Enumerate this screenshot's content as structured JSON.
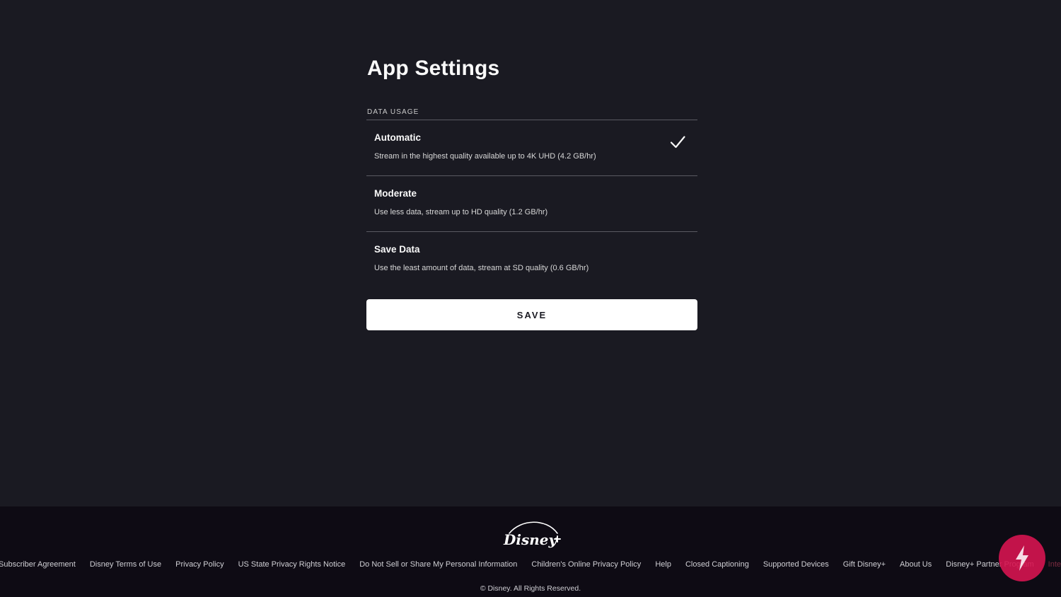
{
  "page": {
    "title": "App Settings"
  },
  "data_usage": {
    "section_label": "DATA USAGE",
    "options": [
      {
        "name": "Automatic",
        "description": "Stream in the highest quality available up to 4K UHD (4.2 GB/hr)",
        "selected": true
      },
      {
        "name": "Moderate",
        "description": "Use less data, stream up to HD quality (1.2 GB/hr)",
        "selected": false
      },
      {
        "name": "Save Data",
        "description": "Use the least amount of data, stream at SD quality (0.6 GB/hr)",
        "selected": false
      }
    ],
    "selected_icon": "checkmark-icon"
  },
  "actions": {
    "save_label": "SAVE"
  },
  "footer": {
    "logo_icon": "disney-plus-logo",
    "links": [
      "Subscriber Agreement",
      "Disney Terms of Use",
      "Privacy Policy",
      "US State Privacy Rights Notice",
      "Do Not Sell or Share My Personal Information",
      "Children's Online Privacy Policy",
      "Help",
      "Closed Captioning",
      "Supported Devices",
      "Gift Disney+",
      "About Us",
      "Disney+ Partner Program",
      "Interest-based Ads"
    ],
    "copyright": "© Disney. All Rights Reserved."
  },
  "floating_button": {
    "icon": "lightning-bolt-icon",
    "color": "#d61450"
  },
  "colors": {
    "background": "#1a1a22",
    "footer_background": "#0e0b14",
    "text": "#f9f9f9",
    "divider": "#5a5a62",
    "button_background": "#ffffff"
  }
}
